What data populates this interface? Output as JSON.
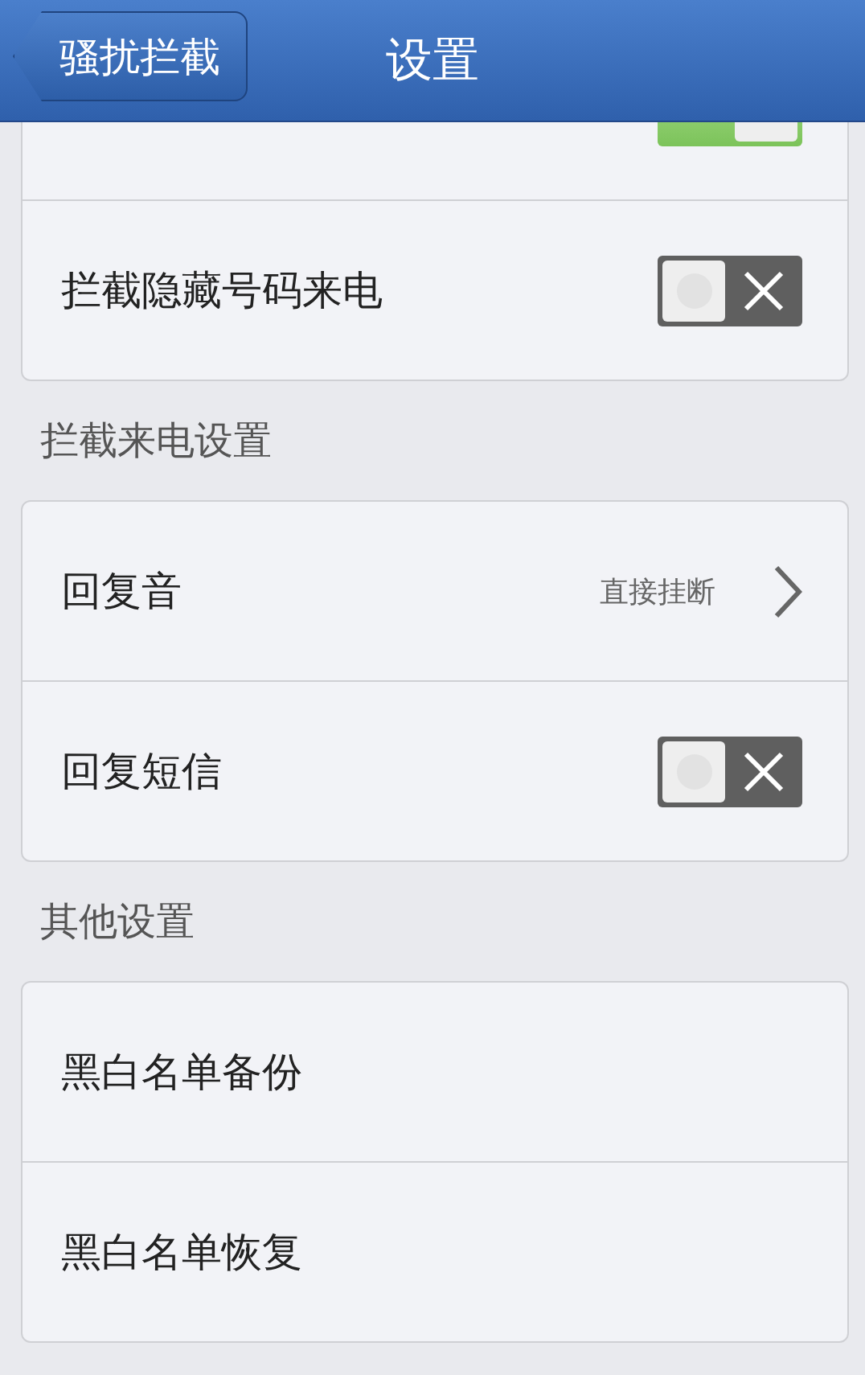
{
  "nav": {
    "back": "骚扰拦截",
    "title": "设置"
  },
  "sections": [
    {
      "rows": [
        {
          "kind": "toggle",
          "on": true
        },
        {
          "kind": "toggle",
          "label": "拦截隐藏号码来电",
          "on": false
        }
      ]
    },
    {
      "header": "拦截来电设置",
      "rows": [
        {
          "kind": "link",
          "label": "回复音",
          "value": "直接挂断"
        },
        {
          "kind": "toggle",
          "label": "回复短信",
          "on": false
        }
      ]
    },
    {
      "header": "其他设置",
      "rows": [
        {
          "kind": "plain",
          "label": "黑白名单备份"
        },
        {
          "kind": "plain",
          "label": "黑白名单恢复"
        }
      ]
    }
  ]
}
